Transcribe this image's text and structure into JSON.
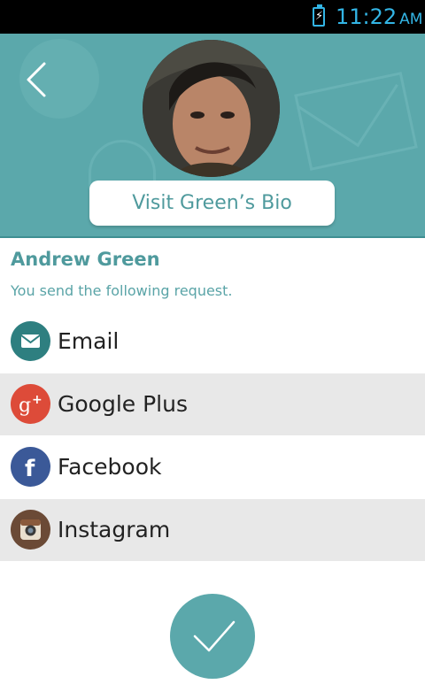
{
  "status_bar": {
    "time": "11:22",
    "ampm": "AM",
    "accent": "#33b5e5"
  },
  "header": {
    "bio_button": "Visit Green’s Bio",
    "background": "#5ba8ab"
  },
  "profile": {
    "name": "Andrew Green",
    "request_text": "You send the following request."
  },
  "options": [
    {
      "label": "Email",
      "icon": "email-icon",
      "color": "#2e7f80"
    },
    {
      "label": "Google Plus",
      "icon": "google-plus-icon",
      "color": "#dd4b39"
    },
    {
      "label": "Facebook",
      "icon": "facebook-icon",
      "color": "#3b5998"
    },
    {
      "label": "Instagram",
      "icon": "instagram-icon",
      "color": "#6b4a36"
    }
  ]
}
